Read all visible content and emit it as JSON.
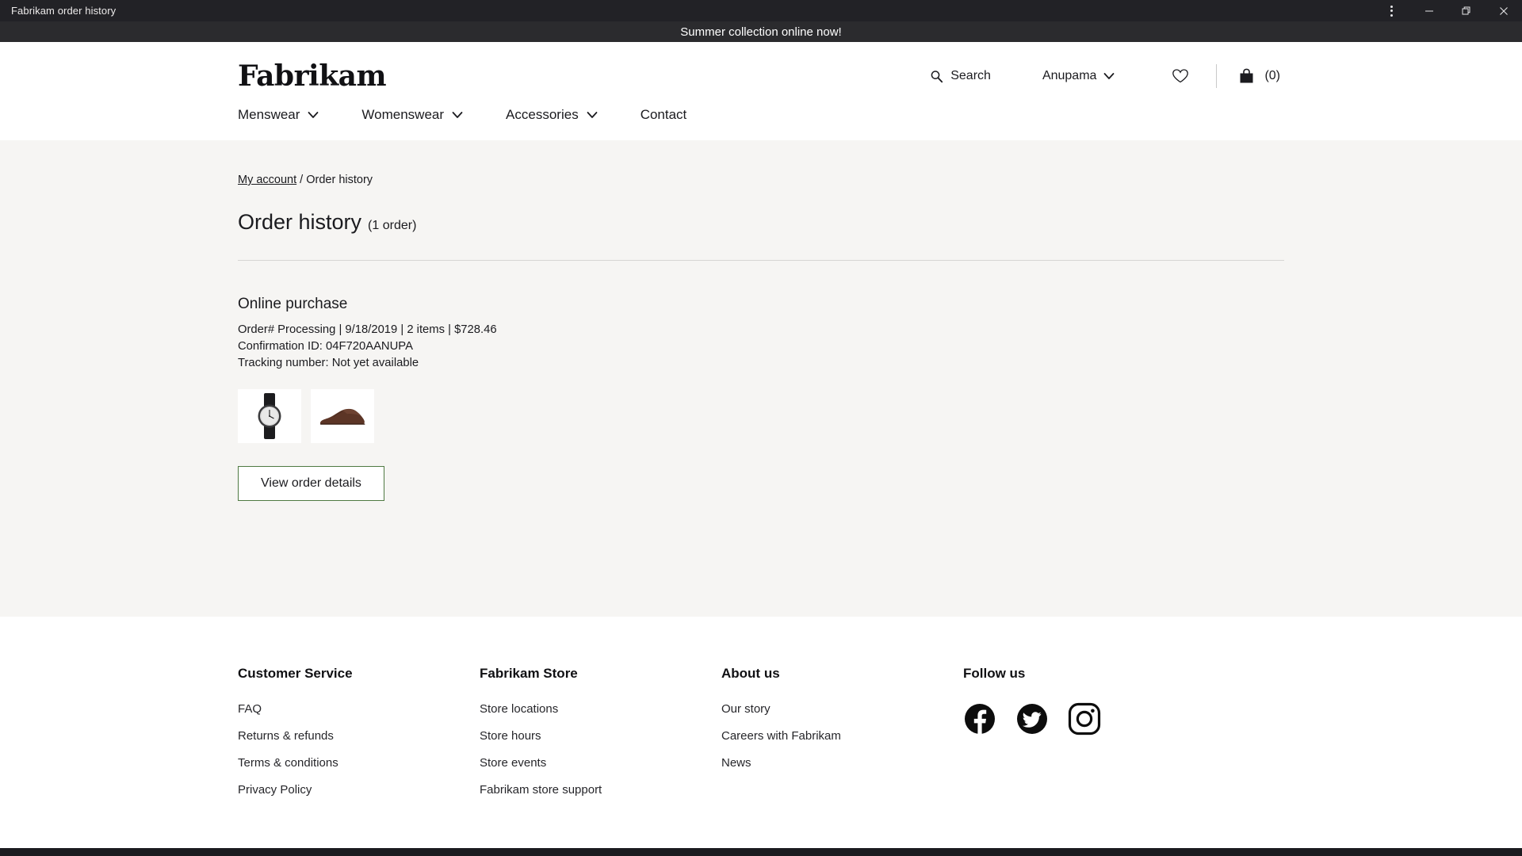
{
  "window": {
    "title": "Fabrikam order history",
    "controls": [
      {
        "name": "more-options",
        "icon": "vertical-dots-icon"
      },
      {
        "name": "minimize",
        "icon": "minimize-icon"
      },
      {
        "name": "restore",
        "icon": "restore-icon"
      },
      {
        "name": "close",
        "icon": "close-icon"
      }
    ]
  },
  "promo": {
    "text": "Summer collection online now!"
  },
  "header": {
    "logo": "Fabrikam",
    "search_label": "Search",
    "account_label": "Anupama",
    "bag_count": "(0)",
    "nav": [
      {
        "label": "Menswear",
        "has_chevron": true
      },
      {
        "label": "Womenswear",
        "has_chevron": true
      },
      {
        "label": "Accessories",
        "has_chevron": true
      },
      {
        "label": "Contact",
        "has_chevron": false
      }
    ]
  },
  "breadcrumb": {
    "link": "My account",
    "separator": "/",
    "current": "Order history"
  },
  "page": {
    "title": "Order history",
    "count": "(1 order)"
  },
  "order": {
    "kind": "Online purchase",
    "summary": "Order# Processing | 9/18/2019 | 2 items | $728.46",
    "confirmation": "Confirmation ID: 04F720AANUPA",
    "tracking": "Tracking number: Not yet available",
    "items": [
      {
        "name": "wristwatch-thumbnail"
      },
      {
        "name": "dress-shoe-thumbnail"
      }
    ],
    "view_details_label": "View order details"
  },
  "footer": {
    "columns": [
      {
        "heading": "Customer Service",
        "links": [
          "FAQ",
          "Returns & refunds",
          "Terms & conditions",
          "Privacy Policy"
        ]
      },
      {
        "heading": "Fabrikam Store",
        "links": [
          "Store locations",
          "Store hours",
          "Store events",
          "Fabrikam store support"
        ]
      },
      {
        "heading": "About us",
        "links": [
          "Our story",
          "Careers with Fabrikam",
          "News"
        ]
      }
    ],
    "follow": {
      "heading": "Follow us",
      "socials": [
        "facebook-icon",
        "twitter-icon",
        "instagram-icon"
      ]
    }
  },
  "colors": {
    "titlebar": "#222226",
    "promo": "#2b2b2e",
    "main_bg": "#f6f5f3",
    "button_border": "#4f7a42",
    "text": "#1b1b1f"
  }
}
